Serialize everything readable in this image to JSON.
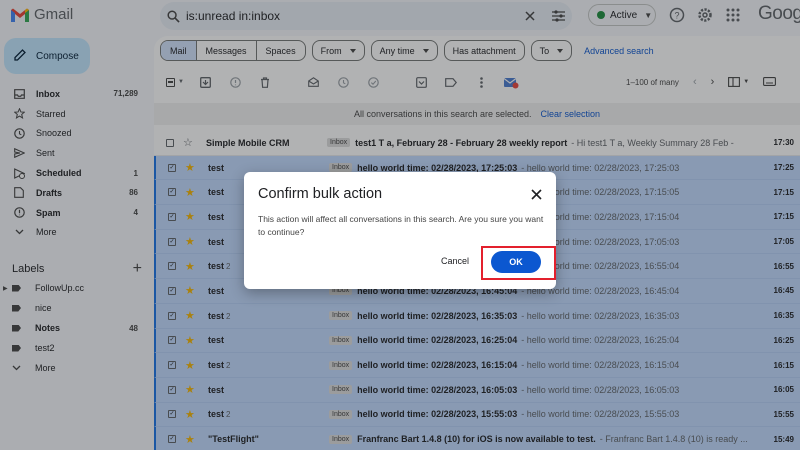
{
  "app": {
    "name": "Gmail"
  },
  "search": {
    "query": "is:unread in:inbox"
  },
  "status": {
    "label": "Active"
  },
  "header": {
    "google_word": "Google"
  },
  "sidebar": {
    "compose_label": "Compose",
    "items": [
      {
        "icon": "inbox-icon",
        "label": "Inbox",
        "count": "71,289",
        "bold": true
      },
      {
        "icon": "star-icon",
        "label": "Starred",
        "count": "",
        "bold": false
      },
      {
        "icon": "clock-icon",
        "label": "Snoozed",
        "count": "",
        "bold": false
      },
      {
        "icon": "send-icon",
        "label": "Sent",
        "count": "",
        "bold": false
      },
      {
        "icon": "scheduled-icon",
        "label": "Scheduled",
        "count": "1",
        "bold": true
      },
      {
        "icon": "draft-icon",
        "label": "Drafts",
        "count": "86",
        "bold": true
      },
      {
        "icon": "spam-icon",
        "label": "Spam",
        "count": "4",
        "bold": true
      },
      {
        "icon": "chevron-down-icon",
        "label": "More",
        "count": "",
        "bold": false
      }
    ],
    "labels_heading": "Labels",
    "labels": [
      {
        "label": "FollowUp.cc",
        "count": "",
        "bold": false,
        "expandable": true
      },
      {
        "label": "nice",
        "count": "",
        "bold": false,
        "expandable": false
      },
      {
        "label": "Notes",
        "count": "48",
        "bold": true,
        "expandable": false
      },
      {
        "label": "test2",
        "count": "",
        "bold": false,
        "expandable": false
      },
      {
        "label": "More",
        "count": "",
        "bold": false,
        "expandable": false,
        "more": true
      }
    ]
  },
  "filters": {
    "segments": [
      "Mail",
      "Messages",
      "Spaces"
    ],
    "active_segment": "Mail",
    "chips": [
      "From",
      "Any time",
      "Has attachment",
      "To"
    ],
    "advanced_search": "Advanced search"
  },
  "toolbar": {
    "pagination": "1–100 of many"
  },
  "banner": {
    "text": "All conversations in this search are selected.",
    "clear_link": "Clear selection"
  },
  "emails": [
    {
      "sender": "Simple Mobile CRM",
      "count": "",
      "starred": false,
      "selected": false,
      "tag": "Inbox",
      "subject": "test1 T a, February 28 - February 28 weekly report",
      "snippet": "- Hi test1 T a, Weekly Summary 28 Feb -",
      "time": "17:30"
    },
    {
      "sender": "test",
      "count": "",
      "starred": true,
      "selected": true,
      "tag": "Inbox",
      "subject": "hello world time: 02/28/2023, 17:25:03",
      "snippet": "- hello world time: 02/28/2023, 17:25:03",
      "time": "17:25"
    },
    {
      "sender": "test",
      "count": "",
      "starred": true,
      "selected": true,
      "tag": "Inbox",
      "subject": "hello world time: 02/28/2023, 17:15:05",
      "snippet": "- hello world time: 02/28/2023, 17:15:05",
      "time": "17:15"
    },
    {
      "sender": "test",
      "count": "",
      "starred": true,
      "selected": true,
      "tag": "Inbox",
      "subject": "hello world time: 02/28/2023, 17:15:04",
      "snippet": "- hello world time: 02/28/2023, 17:15:04",
      "time": "17:15"
    },
    {
      "sender": "test",
      "count": "",
      "starred": true,
      "selected": true,
      "tag": "Inbox",
      "subject": "hello world time: 02/28/2023, 17:05:03",
      "snippet": "- hello world time: 02/28/2023, 17:05:03",
      "time": "17:05"
    },
    {
      "sender": "test",
      "count": "2",
      "starred": true,
      "selected": true,
      "tag": "Inbox",
      "subject": "hello world time: 02/28/2023, 16:55:04",
      "snippet": "- hello world time: 02/28/2023, 16:55:04",
      "time": "16:55"
    },
    {
      "sender": "test",
      "count": "",
      "starred": true,
      "selected": true,
      "tag": "Inbox",
      "subject": "hello world time: 02/28/2023, 16:45:04",
      "snippet": "- hello world time: 02/28/2023, 16:45:04",
      "time": "16:45"
    },
    {
      "sender": "test",
      "count": "2",
      "starred": true,
      "selected": true,
      "tag": "Inbox",
      "subject": "hello world time: 02/28/2023, 16:35:03",
      "snippet": "- hello world time: 02/28/2023, 16:35:03",
      "time": "16:35"
    },
    {
      "sender": "test",
      "count": "",
      "starred": true,
      "selected": true,
      "tag": "Inbox",
      "subject": "hello world time: 02/28/2023, 16:25:04",
      "snippet": "- hello world time: 02/28/2023, 16:25:04",
      "time": "16:25"
    },
    {
      "sender": "test",
      "count": "2",
      "starred": true,
      "selected": true,
      "tag": "Inbox",
      "subject": "hello world time: 02/28/2023, 16:15:04",
      "snippet": "- hello world time: 02/28/2023, 16:15:04",
      "time": "16:15"
    },
    {
      "sender": "test",
      "count": "",
      "starred": true,
      "selected": true,
      "tag": "Inbox",
      "subject": "hello world time: 02/28/2023, 16:05:03",
      "snippet": "- hello world time: 02/28/2023, 16:05:03",
      "time": "16:05"
    },
    {
      "sender": "test",
      "count": "2",
      "starred": true,
      "selected": true,
      "tag": "Inbox",
      "subject": "hello world time: 02/28/2023, 15:55:03",
      "snippet": "- hello world time: 02/28/2023, 15:55:03",
      "time": "15:55"
    },
    {
      "sender": "\"TestFlight\"",
      "count": "",
      "starred": true,
      "selected": true,
      "tag": "Inbox",
      "subject": "Franfranc Bart 1.4.8 (10) for iOS is now available to test.",
      "snippet": "- Franfranc Bart 1.4.8 (10) is ready ...",
      "time": "15:49"
    }
  ],
  "dialog": {
    "title": "Confirm bulk action",
    "body": "This action will affect all conversations in this search. Are you sure you want to continue?",
    "cancel_label": "Cancel",
    "ok_label": "OK"
  },
  "colors": {
    "accent": "#0b57d0",
    "compose_bg": "#c2e7ff",
    "selected_row": "#c2dbff",
    "star": "#f4b400",
    "highlight_box": "#e3202d"
  }
}
